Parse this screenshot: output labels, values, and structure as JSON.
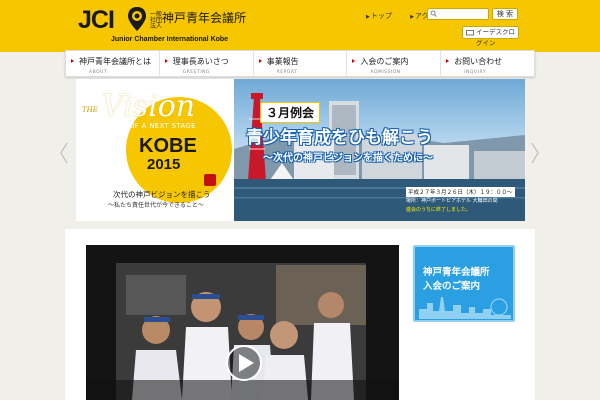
{
  "header": {
    "logo_text": "JCI",
    "corp_type": "一般社団法人",
    "org_name_ja": "神戸青年会議所",
    "org_name_en": "Junior Chamber International Kobe",
    "top_links": [
      "トップ",
      "アクセス"
    ],
    "search_placeholder": "",
    "search_button": "検 索",
    "login_button": "イーデスクログイン"
  },
  "nav": {
    "items": [
      {
        "label": "神戸青年会議所とは",
        "sub": "ABOUT"
      },
      {
        "label": "理事長あいさつ",
        "sub": "GREETING"
      },
      {
        "label": "事業報告",
        "sub": "REPORT"
      },
      {
        "label": "入会のご案内",
        "sub": "ADMISSION"
      },
      {
        "label": "お問い合わせ",
        "sub": "INQUIRY"
      }
    ]
  },
  "hero": {
    "the": "THE",
    "vision": "Vision",
    "next_stage": "OF A NEXT STAGE",
    "kobe": "KOBE",
    "year": "2015",
    "tagline": "次代の神戸ビジョンを描こう",
    "subtagline": "〜私たち責任世代が今できること〜",
    "month_badge": "３月例会",
    "headline": "青少年育成をひも解こう",
    "subheadline": "〜次代の神戸ビジョンを描くために〜",
    "date": "平成２７年３月２６日（木）１９：００〜",
    "venue": "場所：神戸ポートピアホテル 大輪田の間",
    "closed": "盛会のうちに終了しました。"
  },
  "banner": {
    "line1": "神戸青年会議所",
    "line2": "入会のご案内"
  },
  "colors": {
    "brand_yellow": "#f6c600",
    "accent_blue": "#2aa0e2",
    "nav_arrow": "#d40000"
  }
}
